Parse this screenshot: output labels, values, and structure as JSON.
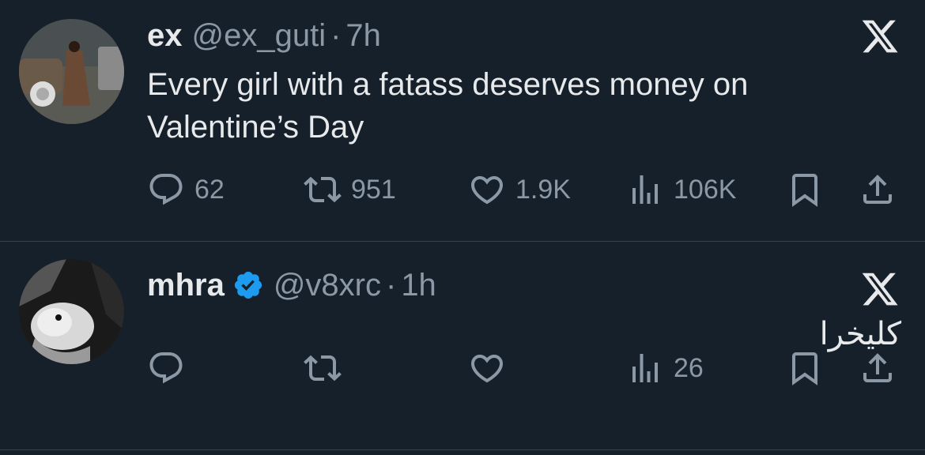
{
  "tweets": [
    {
      "display_name": "ex",
      "handle": "@ex_guti",
      "separator": "·",
      "time": "7h",
      "verified": false,
      "text": "Every girl with a fatass deserves money on Valentine’s Day",
      "replies": "62",
      "retweets": "951",
      "likes": "1.9K",
      "views": "106K",
      "avatar_icon": "person-with-cars-photo"
    },
    {
      "display_name": "mhra",
      "handle": "@v8xrc",
      "separator": "·",
      "time": "1h",
      "verified": true,
      "text": "كليخرا",
      "replies": "",
      "retweets": "",
      "likes": "",
      "views": "26",
      "avatar_icon": "animal-bw-photo"
    }
  ],
  "icons": {
    "reply": "reply-icon",
    "retweet": "retweet-icon",
    "like": "heart-icon",
    "views": "views-icon",
    "bookmark": "bookmark-icon",
    "share": "share-icon",
    "brand": "x-logo-icon",
    "verified": "verified-badge-icon"
  },
  "colors": {
    "background": "#15202b",
    "text": "#e7e9ea",
    "muted": "#8b98a5",
    "divider": "#38444d",
    "verified": "#1d9bf0"
  }
}
